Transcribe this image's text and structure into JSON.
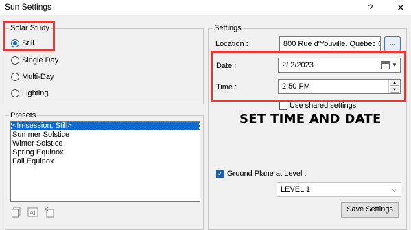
{
  "window": {
    "title": "Sun Settings",
    "help_label": "?",
    "close_label": "✕"
  },
  "solar_study": {
    "legend": "Solar Study",
    "options": [
      "Still",
      "Single Day",
      "Multi-Day",
      "Lighting"
    ],
    "selected": "Still"
  },
  "presets": {
    "legend": "Presets",
    "items": [
      "<In-session, Still>",
      "Summer Solstice",
      "Winter Solstice",
      "Spring Equinox",
      "Fall Equinox"
    ],
    "selected": "<In-session, Still>"
  },
  "settings": {
    "legend": "Settings",
    "location_label": "Location :",
    "location_value": "800 Rue d'Youville, Québec Q",
    "browse_label": "...",
    "date_label": "Date :",
    "date_value": "2/  2/2023",
    "time_label": "Time :",
    "time_value": "2:50 PM",
    "shared_label": "Use shared settings",
    "shared_checked": false,
    "ground_plane_label": "Ground Plane at Level :",
    "ground_plane_checked": true,
    "level_value": "LEVEL 1",
    "save_label": "Save Settings"
  },
  "annotation": {
    "text": "SET TIME AND DATE",
    "highlight_color": "#e53935"
  },
  "icons": [
    "duplicate-icon",
    "rename-icon",
    "delete-icon",
    "calendar-icon",
    "chevron-down-icon",
    "spin-up-icon",
    "spin-down-icon"
  ]
}
